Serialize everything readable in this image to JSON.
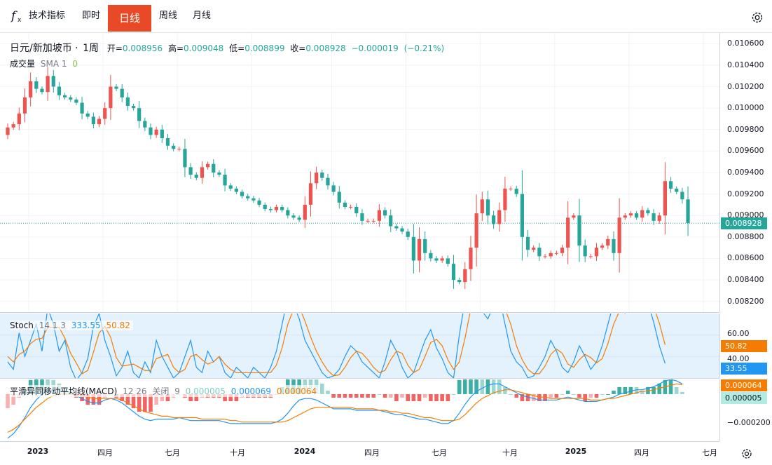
{
  "toolbar": {
    "indicators_label": "技术指标",
    "intervals": [
      {
        "label": "即时",
        "active": false
      },
      {
        "label": "日线",
        "active": true
      },
      {
        "label": "周线",
        "active": false
      },
      {
        "label": "月线",
        "active": false
      }
    ],
    "icons": {
      "indicators": "function-fx-icon",
      "settings": "gear-icon"
    }
  },
  "legend": {
    "symbol": "日元/新加坡币",
    "interval": "1周",
    "open_label": "开=",
    "open": "0.008956",
    "high_label": "高=",
    "high": "0.009048",
    "low_label": "低=",
    "low": "0.008899",
    "close_label": "收=",
    "close": "0.008928",
    "change": "−0.000019",
    "change_pct": "(−0.21%)",
    "volume_label": "成交量",
    "volume_ma": "SMA 1",
    "volume_value": "0"
  },
  "stoch_legend": {
    "name": "Stoch",
    "params": "14 1 3",
    "k": "333.55",
    "d": "50.82"
  },
  "macd_legend": {
    "name": "平滑异同移动平均线(MACD)",
    "params": "12 26",
    "source": "关闭",
    "signal_len": "9",
    "hist": "0.000005",
    "macd": "0.000069",
    "signal": "0.000064"
  },
  "colors": {
    "up": "#ef5350",
    "down": "#26a69a",
    "accent": "#e84a27",
    "stoch_k": "#2196f3",
    "stoch_d": "#f57c00",
    "stoch_band": "#e3f2fd",
    "hist_pos": "#26a69a",
    "hist_neg": "#ef5350"
  },
  "axes": {
    "price_ticks": [
      "0.010600",
      "0.010400",
      "0.010200",
      "0.010000",
      "0.009800",
      "0.009600",
      "0.009400",
      "0.009200",
      "0.009000",
      "0.008800",
      "0.008600",
      "0.008400",
      "0.008200"
    ],
    "price_tag": "0.008928",
    "stoch_ticks": [
      "60.00",
      "40.00"
    ],
    "stoch_tag_d": "50.82",
    "stoch_tag_k": "33.55",
    "macd_ticks": [
      "−0.000200"
    ],
    "macd_tag_signal": "0.000064",
    "macd_tag_hist": "0.000005",
    "time_ticks": [
      {
        "label": "2023",
        "bold": true
      },
      {
        "label": "四月",
        "bold": false
      },
      {
        "label": "七月",
        "bold": false
      },
      {
        "label": "十月",
        "bold": false
      },
      {
        "label": "2024",
        "bold": true
      },
      {
        "label": "四月",
        "bold": false
      },
      {
        "label": "七月",
        "bold": false
      },
      {
        "label": "十月",
        "bold": false
      },
      {
        "label": "2025",
        "bold": true
      },
      {
        "label": "四月",
        "bold": false
      },
      {
        "label": "七月",
        "bold": false
      }
    ]
  },
  "chart_data": [
    {
      "type": "candlestick",
      "title": "日元/新加坡币 · 1周",
      "x_unit": "week",
      "x_start": "2022-12-26",
      "ylim": [
        0.0081,
        0.0107
      ],
      "last_close": 0.008928,
      "series": [
        {
          "name": "close",
          "values": [
            0.00982,
            0.00985,
            0.00995,
            0.0101,
            0.01025,
            0.01018,
            0.01015,
            0.0103,
            0.0102,
            0.01012,
            0.0101,
            0.01008,
            0.01005,
            0.00995,
            0.00992,
            0.00985,
            0.0099,
            0.01,
            0.0102,
            0.01018,
            0.0101,
            0.01002,
            0.01,
            0.00988,
            0.00982,
            0.00975,
            0.0098,
            0.00972,
            0.00965,
            0.00962,
            0.00962,
            0.00945,
            0.00938,
            0.00935,
            0.00945,
            0.00948,
            0.0094,
            0.00938,
            0.00928,
            0.00925,
            0.00922,
            0.00918,
            0.00916,
            0.00914,
            0.0091,
            0.00906,
            0.00905,
            0.00908,
            0.00905,
            0.009,
            0.00898,
            0.00896,
            0.0091,
            0.0093,
            0.0094,
            0.00935,
            0.00928,
            0.00922,
            0.00912,
            0.00908,
            0.00908,
            0.00902,
            0.00895,
            0.00895,
            0.00895,
            0.00905,
            0.009,
            0.0089,
            0.00888,
            0.00885,
            0.0088,
            0.00858,
            0.00878,
            0.00865,
            0.0086,
            0.00858,
            0.0086,
            0.00855,
            0.0084,
            0.00838,
            0.0085,
            0.0087,
            0.00902,
            0.00915,
            0.009,
            0.00892,
            0.00905,
            0.00925,
            0.00925,
            0.0092,
            0.0088,
            0.00868,
            0.0087,
            0.00862,
            0.00862,
            0.00865,
            0.00865,
            0.0087,
            0.00898,
            0.009,
            0.00872,
            0.00862,
            0.00862,
            0.0087,
            0.00872,
            0.00878,
            0.00865,
            0.00898,
            0.009,
            0.00902,
            0.00898,
            0.00905,
            0.00902,
            0.00895,
            0.009,
            0.00932,
            0.00925,
            0.00922,
            0.00915,
            0.00893
          ]
        },
        {
          "name": "open",
          "values": [
            0.00975,
            0.00982,
            0.00985,
            0.00995,
            0.0101,
            0.01025,
            0.01018,
            0.01015,
            0.0103,
            0.0102,
            0.01012,
            0.0101,
            0.01008,
            0.01005,
            0.00995,
            0.00992,
            0.00985,
            0.0099,
            0.01,
            0.0102,
            0.01018,
            0.0101,
            0.01002,
            0.01,
            0.00988,
            0.00982,
            0.00975,
            0.0098,
            0.00972,
            0.00965,
            0.00962,
            0.00962,
            0.00945,
            0.00938,
            0.00935,
            0.00945,
            0.00948,
            0.0094,
            0.00938,
            0.00928,
            0.00925,
            0.00922,
            0.00918,
            0.00916,
            0.00914,
            0.0091,
            0.00906,
            0.00905,
            0.00908,
            0.00905,
            0.009,
            0.00898,
            0.00896,
            0.0091,
            0.0093,
            0.0094,
            0.00935,
            0.00928,
            0.00922,
            0.00912,
            0.00908,
            0.00908,
            0.00902,
            0.00895,
            0.00895,
            0.00895,
            0.00905,
            0.009,
            0.0089,
            0.00888,
            0.00885,
            0.0088,
            0.00858,
            0.00878,
            0.00865,
            0.0086,
            0.00858,
            0.0086,
            0.00855,
            0.0084,
            0.00838,
            0.0085,
            0.0087,
            0.00902,
            0.00915,
            0.009,
            0.00892,
            0.00905,
            0.00925,
            0.00925,
            0.0092,
            0.0088,
            0.00868,
            0.0087,
            0.00862,
            0.00862,
            0.00865,
            0.00865,
            0.0087,
            0.00898,
            0.009,
            0.00872,
            0.00862,
            0.00862,
            0.0087,
            0.00872,
            0.00878,
            0.00865,
            0.00898,
            0.009,
            0.00902,
            0.00898,
            0.00905,
            0.00902,
            0.00895,
            0.009,
            0.00932,
            0.00925,
            0.00922,
            0.00915
          ]
        }
      ]
    },
    {
      "type": "line",
      "title": "Stoch 14 1 3",
      "ylim": [
        20,
        80
      ],
      "series": [
        {
          "name": "%K",
          "values": [
            35,
            28,
            62,
            40,
            55,
            70,
            45,
            85,
            70,
            45,
            55,
            30,
            18,
            25,
            38,
            68,
            80,
            55,
            40,
            22,
            30,
            45,
            25,
            20,
            35,
            25,
            55,
            40,
            30,
            20,
            25,
            40,
            55,
            30,
            25,
            45,
            35,
            40,
            25,
            20,
            30,
            25,
            20,
            30,
            25,
            20,
            30,
            45,
            70,
            95,
            88,
            75,
            55,
            45,
            35,
            25,
            20,
            22,
            28,
            40,
            50,
            45,
            35,
            30,
            25,
            20,
            35,
            55,
            45,
            30,
            20,
            25,
            40,
            55,
            65,
            48,
            38,
            25,
            20,
            60,
            92,
            100,
            95,
            82,
            75,
            88,
            95,
            70,
            45,
            35,
            30,
            20,
            22,
            30,
            40,
            55,
            45,
            30,
            25,
            35,
            50,
            40,
            28,
            35,
            50,
            70,
            90,
            85,
            80,
            92,
            100,
            95,
            90,
            72,
            50,
            33.55
          ]
        },
        {
          "name": "%D",
          "values": [
            40,
            35,
            42,
            45,
            52,
            56,
            57,
            67,
            67,
            67,
            57,
            43,
            34,
            24,
            27,
            44,
            62,
            68,
            58,
            39,
            31,
            32,
            33,
            30,
            27,
            27,
            38,
            40,
            42,
            30,
            25,
            28,
            40,
            42,
            37,
            33,
            35,
            40,
            33,
            28,
            25,
            25,
            25,
            25,
            25,
            25,
            25,
            32,
            48,
            70,
            84,
            86,
            73,
            58,
            45,
            35,
            27,
            22,
            23,
            30,
            39,
            45,
            43,
            37,
            30,
            25,
            27,
            37,
            45,
            43,
            32,
            25,
            28,
            40,
            53,
            56,
            50,
            37,
            28,
            35,
            57,
            84,
            96,
            92,
            84,
            82,
            86,
            84,
            70,
            50,
            37,
            28,
            24,
            24,
            31,
            42,
            47,
            43,
            33,
            30,
            37,
            42,
            39,
            34,
            38,
            52,
            70,
            82,
            85,
            86,
            91,
            96,
            95,
            86,
            71,
            50.82
          ]
        }
      ]
    },
    {
      "type": "line",
      "title": "MACD 12 26",
      "ylim": [
        -0.00032,
        0.0001
      ],
      "series": [
        {
          "name": "MACD",
          "values": [
            -0.0003,
            -0.00027,
            -0.00022,
            -0.00016,
            -9e-05,
            -4e-05,
            0.0,
            2e-05,
            3e-05,
            3e-05,
            2e-05,
            1e-05,
            -1e-05,
            -3e-05,
            -5e-05,
            -6e-05,
            -6e-05,
            -4e-05,
            -3e-05,
            -4e-05,
            -6e-05,
            -9e-05,
            -0.00012,
            -0.00015,
            -0.00017,
            -0.00018,
            -0.00017,
            -0.00017,
            -0.00017,
            -0.00017,
            -0.00016,
            -0.00017,
            -0.00018,
            -0.00018,
            -0.00018,
            -0.00018,
            -0.00018,
            -0.00018,
            -0.00019,
            -0.0002,
            -0.0002,
            -0.0002,
            -0.0002,
            -0.0002,
            -0.0002,
            -0.0002,
            -0.0002,
            -0.00019,
            -0.00017,
            -0.00013,
            -8e-05,
            -4e-05,
            -3e-05,
            -3e-05,
            -4e-05,
            -6e-05,
            -8e-05,
            -0.0001,
            -0.0001,
            -0.0001,
            -0.0001,
            -0.00011,
            -0.00011,
            -0.00011,
            -0.00011,
            -0.00011,
            -0.00012,
            -0.00013,
            -0.00014,
            -0.00014,
            -0.00015,
            -0.00016,
            -0.00017,
            -0.00017,
            -0.00018,
            -0.00019,
            -0.0002,
            -0.0002,
            -0.00018,
            -0.00013,
            -7e-05,
            -2e-05,
            2e-05,
            4e-05,
            6e-05,
            7e-05,
            7e-05,
            5e-05,
            3e-05,
            1e-05,
            -1e-05,
            -2e-05,
            -3e-05,
            -4e-05,
            -4e-05,
            -4e-05,
            -4e-05,
            -3e-05,
            -2e-05,
            -3e-05,
            -4e-05,
            -5e-05,
            -5e-05,
            -5e-05,
            -4e-05,
            -3e-05,
            -2e-05,
            0.0,
            1e-05,
            2e-05,
            3e-05,
            3e-05,
            4e-05,
            5e-05,
            7e-05,
            9e-05,
            0.0001,
            9e-05,
            7e-05
          ]
        },
        {
          "name": "Signal",
          "values": [
            -0.00026,
            -0.00024,
            -0.00021,
            -0.00017,
            -0.00013,
            -9e-05,
            -6e-05,
            -3e-05,
            -1e-05,
            0.0,
            0.0,
            0.0,
            0.0,
            -1e-05,
            -2e-05,
            -3e-05,
            -3e-05,
            -3e-05,
            -3e-05,
            -3e-05,
            -4e-05,
            -6e-05,
            -8e-05,
            -0.0001,
            -0.00012,
            -0.00013,
            -0.00014,
            -0.00015,
            -0.00015,
            -0.00016,
            -0.00016,
            -0.00016,
            -0.00016,
            -0.00016,
            -0.00017,
            -0.00017,
            -0.00017,
            -0.00017,
            -0.00017,
            -0.00018,
            -0.00018,
            -0.00019,
            -0.00019,
            -0.00019,
            -0.00019,
            -0.00019,
            -0.00019,
            -0.00019,
            -0.00019,
            -0.00018,
            -0.00016,
            -0.00014,
            -0.00012,
            -0.0001,
            -9e-05,
            -9e-05,
            -9e-05,
            -9e-05,
            -9e-05,
            -9e-05,
            -9e-05,
            -0.0001,
            -0.0001,
            -0.0001,
            -0.0001,
            -0.00011,
            -0.00011,
            -0.00012,
            -0.00012,
            -0.00013,
            -0.00013,
            -0.00014,
            -0.00015,
            -0.00016,
            -0.00016,
            -0.00017,
            -0.00018,
            -0.00018,
            -0.00018,
            -0.00017,
            -0.00014,
            -0.0001,
            -6e-05,
            -3e-05,
            -1e-05,
            1e-05,
            2e-05,
            3e-05,
            3e-05,
            2e-05,
            1e-05,
            0.0,
            -1e-05,
            -2e-05,
            -2e-05,
            -3e-05,
            -3e-05,
            -3e-05,
            -3e-05,
            -3e-05,
            -3e-05,
            -3e-05,
            -4e-05,
            -4e-05,
            -4e-05,
            -3e-05,
            -3e-05,
            -2e-05,
            -1e-05,
            0.0,
            1e-05,
            2e-05,
            2e-05,
            3e-05,
            4e-05,
            5e-05,
            6e-05,
            7e-05,
            6.4e-05
          ]
        }
      ]
    }
  ]
}
